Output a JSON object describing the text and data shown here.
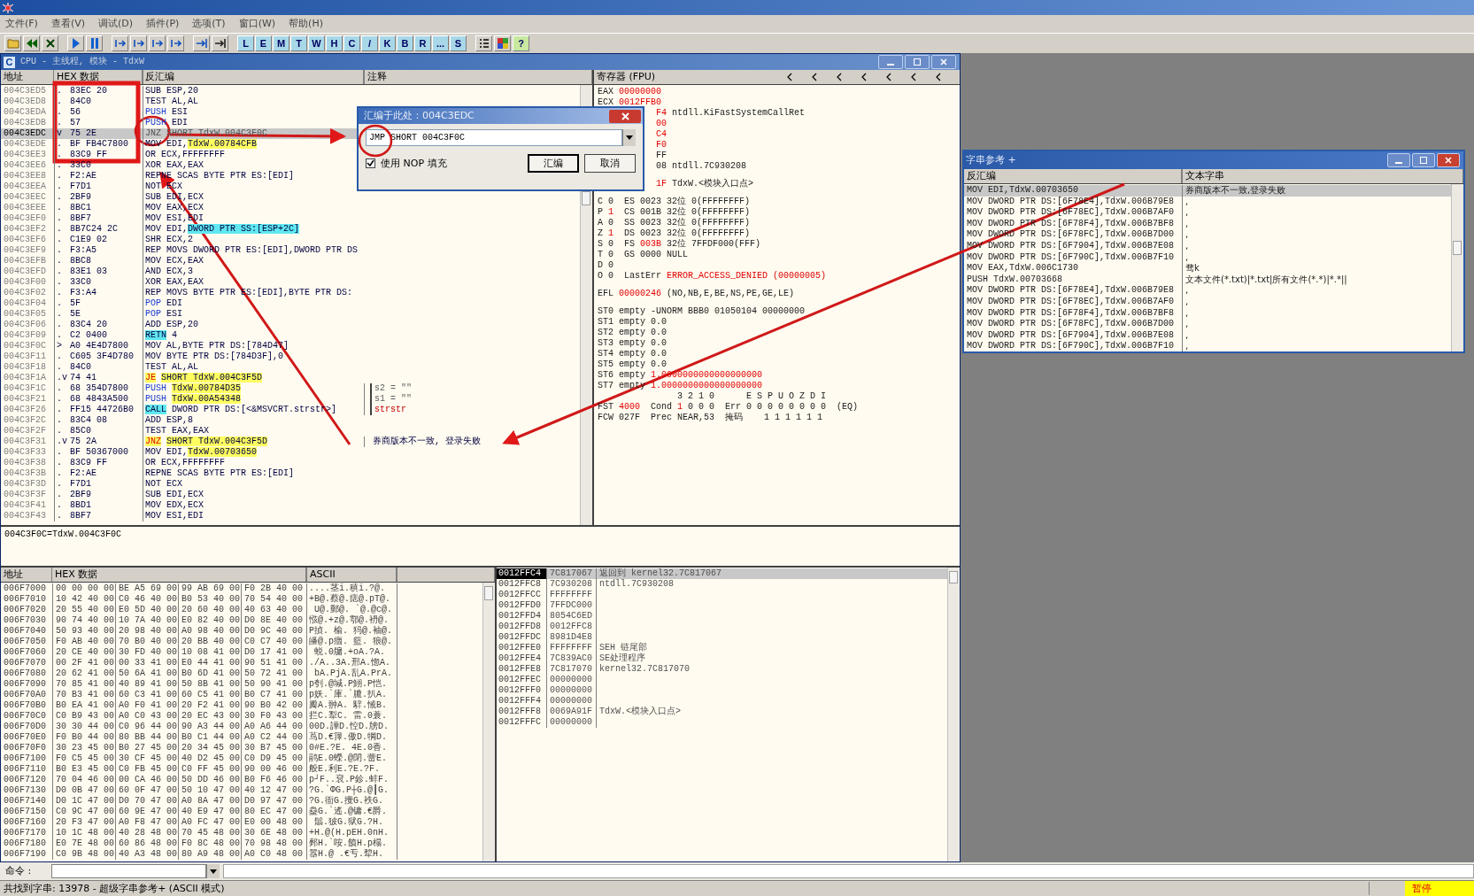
{
  "menu": [
    "文件(F)",
    "查看(V)",
    "调试(D)",
    "插件(P)",
    "选项(T)",
    "窗口(W)",
    "帮助(H)"
  ],
  "toolbar": {
    "letters": [
      "L",
      "E",
      "M",
      "T",
      "W",
      "H",
      "C",
      "/",
      "K",
      "B",
      "R",
      "...",
      "S"
    ],
    "help": "?"
  },
  "cpu_window": {
    "icon_letter": "C",
    "title": "CPU - 主线程, 模块 - TdxW"
  },
  "disasm": {
    "columns": [
      "地址",
      "HEX 数据",
      "反汇编",
      "注释"
    ],
    "rows": [
      {
        "addr": "004C3ED5",
        "mark": ".",
        "hex": "83EC 20",
        "kind": "plain",
        "op": "SUB",
        "args": "ESP,20",
        "selected": false
      },
      {
        "addr": "004C3ED8",
        "mark": ".",
        "hex": "84C0",
        "kind": "plain",
        "op": "TEST",
        "args": "AL,AL",
        "selected": false
      },
      {
        "addr": "004C3EDA",
        "mark": ".",
        "hex": "56",
        "kind": "stack",
        "op": "PUSH",
        "args": "ESI",
        "selected": false
      },
      {
        "addr": "004C3EDB",
        "mark": ".",
        "hex": "57",
        "kind": "stack",
        "op": "PUSH",
        "args": "EDI",
        "selected": false
      },
      {
        "addr": "004C3EDC",
        "mark": "v",
        "hex": "75 2E",
        "kind": "plain",
        "op": "JNZ",
        "args": "SHORT TdxW.004C3F0C",
        "selected": true
      },
      {
        "addr": "004C3EDE",
        "mark": ".",
        "hex": "BF FB4C7800",
        "kind": "plain",
        "op": "MOV",
        "args": "EDI,",
        "hl": {
          "text": "TdxW.00784CFB",
          "color": "#ffff60"
        },
        "selected": false
      },
      {
        "addr": "004C3EE3",
        "mark": ".",
        "hex": "83C9 FF",
        "kind": "plain",
        "op": "OR",
        "args": "ECX,FFFFFFFF",
        "selected": false
      },
      {
        "addr": "004C3EE6",
        "mark": ".",
        "hex": "33C0",
        "kind": "plain",
        "op": "XOR",
        "args": "EAX,EAX",
        "selected": false
      },
      {
        "addr": "004C3EE8",
        "mark": ".",
        "hex": "F2:AE",
        "kind": "plain",
        "op": "REPNE SCAS",
        "args": "BYTE PTR ES:[EDI]",
        "selected": false
      },
      {
        "addr": "004C3EEA",
        "mark": ".",
        "hex": "F7D1",
        "kind": "plain",
        "op": "NOT",
        "args": "ECX",
        "selected": false
      },
      {
        "addr": "004C3EEC",
        "mark": ".",
        "hex": "2BF9",
        "kind": "plain",
        "op": "SUB",
        "args": "EDI,ECX",
        "selected": false
      },
      {
        "addr": "004C3EEE",
        "mark": ".",
        "hex": "8BC1",
        "kind": "plain",
        "op": "MOV",
        "args": "EAX,ECX",
        "selected": false
      },
      {
        "addr": "004C3EF0",
        "mark": ".",
        "hex": "8BF7",
        "kind": "plain",
        "op": "MOV",
        "args": "ESI,EDI",
        "selected": false
      },
      {
        "addr": "004C3EF2",
        "mark": ".",
        "hex": "8B7C24 2C",
        "kind": "plain",
        "op": "MOV",
        "args": "EDI,",
        "hl": {
          "text": "DWORD PTR SS:[ESP+2C]",
          "color": "#60e8f0"
        },
        "selected": false
      },
      {
        "addr": "004C3EF6",
        "mark": ".",
        "hex": "C1E9 02",
        "kind": "plain",
        "op": "SHR",
        "args": "ECX,2",
        "selected": false
      },
      {
        "addr": "004C3EF9",
        "mark": ".",
        "hex": "F3:A5",
        "kind": "plain",
        "op": "REP MOVS",
        "args": "DWORD PTR ES:[EDI],DWORD PTR DS",
        "selected": false
      },
      {
        "addr": "004C3EFB",
        "mark": ".",
        "hex": "8BC8",
        "kind": "plain",
        "op": "MOV",
        "args": "ECX,EAX",
        "selected": false
      },
      {
        "addr": "004C3EFD",
        "mark": ".",
        "hex": "83E1 03",
        "kind": "plain",
        "op": "AND",
        "args": "ECX,3",
        "selected": false
      },
      {
        "addr": "004C3F00",
        "mark": ".",
        "hex": "33C0",
        "kind": "plain",
        "op": "XOR",
        "args": "EAX,EAX",
        "selected": false
      },
      {
        "addr": "004C3F02",
        "mark": ".",
        "hex": "F3:A4",
        "kind": "plain",
        "op": "REP MOVS",
        "args": "BYTE PTR ES:[EDI],BYTE PTR DS:",
        "selected": false
      },
      {
        "addr": "004C3F04",
        "mark": ".",
        "hex": "5F",
        "kind": "stack",
        "op": "POP",
        "args": "EDI",
        "selected": false
      },
      {
        "addr": "004C3F05",
        "mark": ".",
        "hex": "5E",
        "kind": "stack",
        "op": "POP",
        "args": "ESI",
        "selected": false
      },
      {
        "addr": "004C3F06",
        "mark": ".",
        "hex": "83C4 20",
        "kind": "plain",
        "op": "ADD",
        "args": "ESP,20",
        "selected": false
      },
      {
        "addr": "004C3F09",
        "mark": ".",
        "hex": "C2 0400",
        "kind": "call",
        "op": "RETN",
        "args": "4",
        "selected": false
      },
      {
        "addr": "004C3F0C",
        "mark": ">",
        "hex": "A0 4E4D7800",
        "kind": "plain",
        "op": "MOV",
        "args": "AL,BYTE PTR DS:[784D47]",
        "selected": false
      },
      {
        "addr": "004C3F11",
        "mark": ".",
        "hex": "C605 3F4D780",
        "kind": "plain",
        "op": "MOV",
        "args": "BYTE PTR DS:[784D3F],0",
        "selected": false
      },
      {
        "addr": "004C3F18",
        "mark": ".",
        "hex": "84C0",
        "kind": "plain",
        "op": "TEST",
        "args": "AL,AL",
        "selected": false
      },
      {
        "addr": "004C3F1A",
        "mark": ".v",
        "hex": "74 41",
        "kind": "jump",
        "op": "JE",
        "args": "SHORT TdxW.004C3F5D",
        "selected": false
      },
      {
        "addr": "004C3F1C",
        "mark": ".",
        "hex": "68 354D7800",
        "kind": "stack",
        "op": "PUSH",
        "hl": {
          "text": "TdxW.00784D35",
          "color": "#ffff60"
        },
        "comment": {
          "text": "s2 = \"\"",
          "kind": "arg"
        },
        "selected": false
      },
      {
        "addr": "004C3F21",
        "mark": ".",
        "hex": "68 4843A500",
        "kind": "stack",
        "op": "PUSH",
        "hl": {
          "text": "TdxW.00A54348",
          "color": "#ffff60"
        },
        "comment": {
          "text": "s1 = \"\"",
          "kind": "arg"
        },
        "selected": false
      },
      {
        "addr": "004C3F26",
        "mark": ".",
        "hex": "FF15 44726B0",
        "kind": "call",
        "op": "CALL",
        "args": "DWORD PTR DS:[<&MSVCRT.strstr>]",
        "comment": {
          "text": "strstr",
          "kind": "func"
        },
        "selected": false
      },
      {
        "addr": "004C3F2C",
        "mark": ".",
        "hex": "83C4 08",
        "kind": "plain",
        "op": "ADD",
        "args": "ESP,8",
        "selected": false
      },
      {
        "addr": "004C3F2F",
        "mark": ".",
        "hex": "85C0",
        "kind": "plain",
        "op": "TEST",
        "args": "EAX,EAX",
        "selected": false
      },
      {
        "addr": "004C3F31",
        "mark": ".v",
        "hex": "75 2A",
        "kind": "jump",
        "op": "JNZ",
        "args": "SHORT TdxW.004C3F5D",
        "comment": {
          "text": "券商版本不一致, 登录失败",
          "kind": "note"
        },
        "selected": false
      },
      {
        "addr": "004C3F33",
        "mark": ".",
        "hex": "BF 50367000",
        "kind": "plain",
        "op": "MOV",
        "args": "EDI,",
        "hl": {
          "text": "TdxW.00703650",
          "color": "#ffff60"
        },
        "selected": false
      },
      {
        "addr": "004C3F38",
        "mark": ".",
        "hex": "83C9 FF",
        "kind": "plain",
        "op": "OR",
        "args": "ECX,FFFFFFFF",
        "selected": false
      },
      {
        "addr": "004C3F3B",
        "mark": ".",
        "hex": "F2:AE",
        "kind": "plain",
        "op": "REPNE SCAS",
        "args": "BYTE PTR ES:[EDI]",
        "selected": false
      },
      {
        "addr": "004C3F3D",
        "mark": ".",
        "hex": "F7D1",
        "kind": "plain",
        "op": "NOT",
        "args": "ECX",
        "selected": false
      },
      {
        "addr": "004C3F3F",
        "mark": ".",
        "hex": "2BF9",
        "kind": "plain",
        "op": "SUB",
        "args": "EDI,ECX",
        "selected": false
      },
      {
        "addr": "004C3F41",
        "mark": ".",
        "hex": "8BD1",
        "kind": "plain",
        "op": "MOV",
        "args": "EDX,ECX",
        "selected": false
      },
      {
        "addr": "004C3F43",
        "mark": ".",
        "hex": "8BF7",
        "kind": "plain",
        "op": "MOV",
        "args": "ESI,EDI",
        "selected": false
      }
    ]
  },
  "registers": {
    "title": "寄存器 (FPU)",
    "groups": [
      [
        {
          "kind": "full",
          "parts": [
            {
              "t": "EAX ",
              "changed": false
            },
            {
              "t": "00000000",
              "changed": true
            }
          ]
        },
        {
          "kind": "full",
          "parts": [
            {
              "t": "ECX ",
              "changed": false
            },
            {
              "t": "0012FFB0",
              "changed": true
            }
          ]
        },
        {
          "kind": "clipped",
          "parts": [
            {
              "t": "F4",
              "changed": true
            },
            {
              "t": " ntdll.KiFastSystemCallRet",
              "changed": false
            }
          ]
        },
        {
          "kind": "clipped",
          "parts": [
            {
              "t": "00",
              "changed": true
            }
          ]
        },
        {
          "kind": "clipped",
          "parts": [
            {
              "t": "C4",
              "changed": true
            }
          ]
        },
        {
          "kind": "clipped",
          "parts": [
            {
              "t": "F0",
              "changed": true
            }
          ]
        },
        {
          "kind": "clipped",
          "parts": [
            {
              "t": "FF",
              "changed": false
            }
          ]
        },
        {
          "kind": "clipped",
          "parts": [
            {
              "t": "08 ntdll.7C930208",
              "changed": false
            }
          ]
        }
      ],
      [
        {
          "kind": "clipped",
          "parts": [
            {
              "t": "1F",
              "changed": true
            },
            {
              "t": " TdxW.<模块入口点>",
              "changed": false
            }
          ]
        }
      ],
      [
        {
          "kind": "full",
          "parts": [
            {
              "t": "C 0  ES 0023 32位 0(FFFFFFFF)",
              "changed": false
            }
          ]
        },
        {
          "kind": "full",
          "parts": [
            {
              "t": "P ",
              "changed": false
            },
            {
              "t": "1",
              "changed": true
            },
            {
              "t": "  CS 001B 32位 0(FFFFFFFF)",
              "changed": false
            }
          ]
        },
        {
          "kind": "full",
          "parts": [
            {
              "t": "A 0  SS 0023 32位 0(FFFFFFFF)",
              "changed": false
            }
          ]
        },
        {
          "kind": "full",
          "parts": [
            {
              "t": "Z ",
              "changed": false
            },
            {
              "t": "1",
              "changed": true
            },
            {
              "t": "  DS 0023 32位 0(FFFFFFFF)",
              "changed": false
            }
          ]
        },
        {
          "kind": "full",
          "parts": [
            {
              "t": "S 0  FS ",
              "changed": false
            },
            {
              "t": "003B",
              "changed": true
            },
            {
              "t": " 32位 7FFDF000(FFF)",
              "changed": false
            }
          ]
        },
        {
          "kind": "full",
          "parts": [
            {
              "t": "T 0  GS 0000 NULL",
              "changed": false
            }
          ]
        },
        {
          "kind": "full",
          "parts": [
            {
              "t": "D 0",
              "changed": false
            }
          ]
        },
        {
          "kind": "full",
          "parts": [
            {
              "t": "O 0  LastErr ",
              "changed": false
            },
            {
              "t": "ERROR_ACCESS_DENIED (00000005)",
              "changed": true
            }
          ]
        }
      ],
      [
        {
          "kind": "full",
          "parts": [
            {
              "t": "EFL ",
              "changed": false
            },
            {
              "t": "00000246",
              "changed": true
            },
            {
              "t": " (NO,NB,E,BE,NS,PE,GE,LE)",
              "changed": false
            }
          ]
        }
      ],
      [
        {
          "kind": "full",
          "parts": [
            {
              "t": "ST0 empty -UNORM BBB0 01050104 00000000",
              "changed": false
            }
          ]
        },
        {
          "kind": "full",
          "parts": [
            {
              "t": "ST1 empty 0.0",
              "changed": false
            }
          ]
        },
        {
          "kind": "full",
          "parts": [
            {
              "t": "ST2 empty 0.0",
              "changed": false
            }
          ]
        },
        {
          "kind": "full",
          "parts": [
            {
              "t": "ST3 empty 0.0",
              "changed": false
            }
          ]
        },
        {
          "kind": "full",
          "parts": [
            {
              "t": "ST4 empty 0.0",
              "changed": false
            }
          ]
        },
        {
          "kind": "full",
          "parts": [
            {
              "t": "ST5 empty 0.0",
              "changed": false
            }
          ]
        },
        {
          "kind": "full",
          "parts": [
            {
              "t": "ST6 empty ",
              "changed": false
            },
            {
              "t": "1.0000000000000000000",
              "changed": true
            }
          ]
        },
        {
          "kind": "full",
          "parts": [
            {
              "t": "ST7 empty ",
              "changed": false
            },
            {
              "t": "1.0000000000000000000",
              "changed": true
            }
          ]
        },
        {
          "kind": "full",
          "parts": [
            {
              "t": "               3 2 1 0      E S P U O Z D I",
              "changed": false
            }
          ]
        },
        {
          "kind": "full",
          "parts": [
            {
              "t": "FST ",
              "changed": false
            },
            {
              "t": "4000",
              "changed": true
            },
            {
              "t": "  Cond ",
              "changed": false
            },
            {
              "t": "1",
              "changed": true
            },
            {
              "t": " 0 0 0  Err 0 0 0 0 0 0 0 0  (EQ)",
              "changed": false
            }
          ]
        },
        {
          "kind": "full",
          "parts": [
            {
              "t": "FCW 027F  Prec NEAR,53  掩码    1 1 1 1 1 1",
              "changed": false
            }
          ]
        }
      ]
    ]
  },
  "info_line": "004C3F0C=TdxW.004C3F0C",
  "dump": {
    "columns": [
      "地址",
      "HEX 数据",
      "ASCII"
    ],
    "rows": [
      {
        "addr": "006F7000",
        "hex": "00 00 00 00 BE A5 69 00 99 AB 69 00 F0 2B 40 00",
        "ascii": "....茎i.稹i.?@."
      },
      {
        "addr": "006F7010",
        "hex": "10 42 40 00 C0 46 40 00 B0 53 40 00 70 54 40 00",
        "ascii": "+B@.蔡@.痣@.pT@."
      },
      {
        "addr": "006F7020",
        "hex": "20 55 40 00 E0 5D 40 00 20 60 40 00 40 63 40 00",
        "ascii": " U@.郵@. `@.@c@."
      },
      {
        "addr": "006F7030",
        "hex": "90 74 40 00 10 7A 40 00 E0 82 40 00 D0 8E 40 00",
        "ascii": "惤@.+z@.鄠@.袇@."
      },
      {
        "addr": "006F7040",
        "hex": "50 93 40 00 20 98 40 00 A0 98 40 00 D0 9C 40 00",
        "ascii": "P揁. 榆. 犸@.袖@."
      },
      {
        "addr": "006F7050",
        "hex": "F0 AB 40 00 70 B0 40 00 20 BB 40 00 C0 C7 40 00",
        "ascii": "皤@.p痼. 籃. 狼@."
      },
      {
        "addr": "006F7060",
        "hex": "20 CE 40 00 30 FD 40 00 10 08 41 00 D0 17 41 00",
        "ascii": " 蜕.0牖.+oA.?A."
      },
      {
        "addr": "006F7070",
        "hex": "00 2F 41 00 00 33 41 00 E0 44 41 00 90 51 41 00",
        "ascii": "./A..3A.邢A.惚A."
      },
      {
        "addr": "006F7080",
        "hex": "20 62 41 00 50 6A 41 00 B0 6D 41 00 50 72 41 00",
        "ascii": " bA.PjA.乱A.PrA."
      },
      {
        "addr": "006F7090",
        "hex": "70 85 41 00 40 89 41 00 50 8B 41 00 50 90 41 00",
        "ascii": "p刳.@堿.P鮙.P恺."
      },
      {
        "addr": "006F70A0",
        "hex": "70 B3 41 00 60 C3 41 00 60 C5 41 00 B0 C7 41 00",
        "ascii": "p妖.`庫.`膔.扒A."
      },
      {
        "addr": "006F70B0",
        "hex": "B0 EA 41 00 A0 F0 41 00 20 F2 41 00 90 B0 42 00",
        "ascii": "瓣A.翀A. 騂.悈B."
      },
      {
        "addr": "006F70C0",
        "hex": "C0 B9 43 00 A0 C0 43 00 20 EC 43 00 30 F0 43 00",
        "ascii": "拦C.犁C. 雷.0蓑."
      },
      {
        "addr": "006F70D0",
        "hex": "30 30 44 00 C0 96 44 00 90 A3 44 00 A0 A6 44 00",
        "ascii": "00D.譁D.悾D.牓D."
      },
      {
        "addr": "006F70E0",
        "hex": "F0 B0 44 00 80 BB 44 00 B0 C1 44 00 A0 C2 44 00",
        "ascii": "茑D.€籜.傲D.犅D."
      },
      {
        "addr": "006F70F0",
        "hex": "30 23 45 00 B0 27 45 00 20 34 45 00 30 B7 45 00",
        "ascii": "0#E.?E. 4E.0香."
      },
      {
        "addr": "006F7100",
        "hex": "F0 C5 45 00 30 CF 45 00 40 D2 45 00 C0 D9 45 00",
        "ascii": "鹃E.0蠑.@閉.蕾E."
      },
      {
        "addr": "006F7110",
        "hex": "B0 E3 45 00 C0 FB 45 00 C0 FF 45 00 90 00 46 00",
        "ascii": "般E.利E.?E.?F."
      },
      {
        "addr": "006F7120",
        "hex": "70 04 46 00 00 CA 46 00 50 DD 46 00 B0 F6 46 00",
        "ascii": "p┘F..袞.P鉁.蚌F."
      },
      {
        "addr": "006F7130",
        "hex": "D0 0B 47 00 60 0F 47 00 50 10 47 00 40 12 47 00",
        "ascii": "?G.`ΦG.P┼G.@┃G."
      },
      {
        "addr": "006F7140",
        "hex": "D0 1C 47 00 D0 70 47 00 A0 8A 47 00 D0 97 47 00",
        "ascii": "?G.衜G.攪G.袟G."
      },
      {
        "addr": "006F7150",
        "hex": "C0 9C 47 00 60 9E 47 00 40 E9 47 00 80 EC 47 00",
        "ascii": "蠱G.`遙.@镛.€爵."
      },
      {
        "addr": "006F7160",
        "hex": "20 F3 47 00 A0 F8 47 00 A0 FC 47 00 E0 00 48 00",
        "ascii": " 鬅.狓G.狱G.?H."
      },
      {
        "addr": "006F7170",
        "hex": "10 1C 48 00 40 28 48 00 70 45 48 00 30 6E 48 00",
        "ascii": "+H.@(H.pEH.0nH."
      },
      {
        "addr": "006F7180",
        "hex": "E0 7E 48 00 60 86 48 00 F0 8C 48 00 70 98 48 00",
        "ascii": "鄸H.`咹.饙H.p榻."
      },
      {
        "addr": "006F7190",
        "hex": "C0 9B 48 00 40 A3 48 00 80 A9 48 00 A0 C0 48 00",
        "ascii": "嚣H.@ .€亐.犂H."
      }
    ]
  },
  "stack": [
    {
      "addr": "0012FFC4",
      "value": "7C817067",
      "comment": "返回到 kernel32.7C817067",
      "selected": true
    },
    {
      "addr": "0012FFC8",
      "value": "7C930208",
      "comment": "ntdll.7C930208",
      "selected": false
    },
    {
      "addr": "0012FFCC",
      "value": "FFFFFFFF",
      "selected": false
    },
    {
      "addr": "0012FFD0",
      "value": "7FFDC000",
      "selected": false
    },
    {
      "addr": "0012FFD4",
      "value": "8054C6ED",
      "selected": false
    },
    {
      "addr": "0012FFD8",
      "value": "0012FFC8",
      "selected": false
    },
    {
      "addr": "0012FFDC",
      "value": "8981D4E8",
      "selected": false
    },
    {
      "addr": "0012FFE0",
      "value": "FFFFFFFF",
      "comment": "SEH 链尾部",
      "selected": false
    },
    {
      "addr": "0012FFE4",
      "value": "7C839AC0",
      "comment": "SE处理程序",
      "selected": false
    },
    {
      "addr": "0012FFE8",
      "value": "7C817070",
      "comment": "kernel32.7C817070",
      "selected": false
    },
    {
      "addr": "0012FFEC",
      "value": "00000000",
      "selected": false
    },
    {
      "addr": "0012FFF0",
      "value": "00000000",
      "selected": false
    },
    {
      "addr": "0012FFF4",
      "value": "00000000",
      "selected": false
    },
    {
      "addr": "0012FFF8",
      "value": "0069A91F",
      "comment": "TdxW.<模块入口点>",
      "selected": false
    },
    {
      "addr": "0012FFFC",
      "value": "00000000",
      "selected": false
    }
  ],
  "strings_window": {
    "title": "字串参考 +",
    "columns": [
      "反汇编",
      "文本字串"
    ],
    "rows": [
      {
        "code": "MOV EDI,TdxW.00703650",
        "text": "券商版本不一致,登录失败",
        "selected": true
      },
      {
        "code": "MOV DWORD PTR DS:[6F78E4],TdxW.006B79E8",
        "text": ",",
        "selected": false
      },
      {
        "code": "MOV DWORD PTR DS:[6F78EC],TdxW.006B7AF0",
        "text": ",",
        "selected": false
      },
      {
        "code": "MOV DWORD PTR DS:[6F78F4],TdxW.006B7BF8",
        "text": ",",
        "selected": false
      },
      {
        "code": "MOV DWORD PTR DS:[6F78FC],TdxW.006B7D00",
        "text": ",",
        "selected": false
      },
      {
        "code": "MOV DWORD PTR DS:[6F7904],TdxW.006B7E08",
        "text": ",",
        "selected": false
      },
      {
        "code": "MOV DWORD PTR DS:[6F790C],TdxW.006B7F10",
        "text": ",",
        "selected": false
      },
      {
        "code": "MOV EAX,TdxW.006C1730",
        "text": "骛k",
        "selected": false
      },
      {
        "code": "PUSH TdxW.00703668",
        "text": "文本文件(*.txt)|*.txt|所有文件(*.*)|*.*||",
        "selected": false
      },
      {
        "code": "MOV DWORD PTR DS:[6F78E4],TdxW.006B79E8",
        "text": ",",
        "selected": false
      },
      {
        "code": "MOV DWORD PTR DS:[6F78EC],TdxW.006B7AF0",
        "text": ",",
        "selected": false
      },
      {
        "code": "MOV DWORD PTR DS:[6F78F4],TdxW.006B7BF8",
        "text": ",",
        "selected": false
      },
      {
        "code": "MOV DWORD PTR DS:[6F78FC],TdxW.006B7D00",
        "text": ",",
        "selected": false
      },
      {
        "code": "MOV DWORD PTR DS:[6F7904],TdxW.006B7E08",
        "text": ",",
        "selected": false
      },
      {
        "code": "MOV DWORD PTR DS:[6F790C],TdxW.006B7F10",
        "text": ",",
        "selected": false
      }
    ]
  },
  "dialog": {
    "title": "汇编于此处：004C3EDC",
    "value": "JMP SHORT 004C3F0C",
    "use_nop": {
      "label": "使用 NOP 填充",
      "checked": true
    },
    "buttons": [
      "汇编",
      "取消"
    ]
  },
  "command": {
    "label": "命令 :"
  },
  "status": {
    "text": "共找到字串: 13978 - 超级字串参考+ (ASCII 模式)",
    "state": "暂停"
  }
}
